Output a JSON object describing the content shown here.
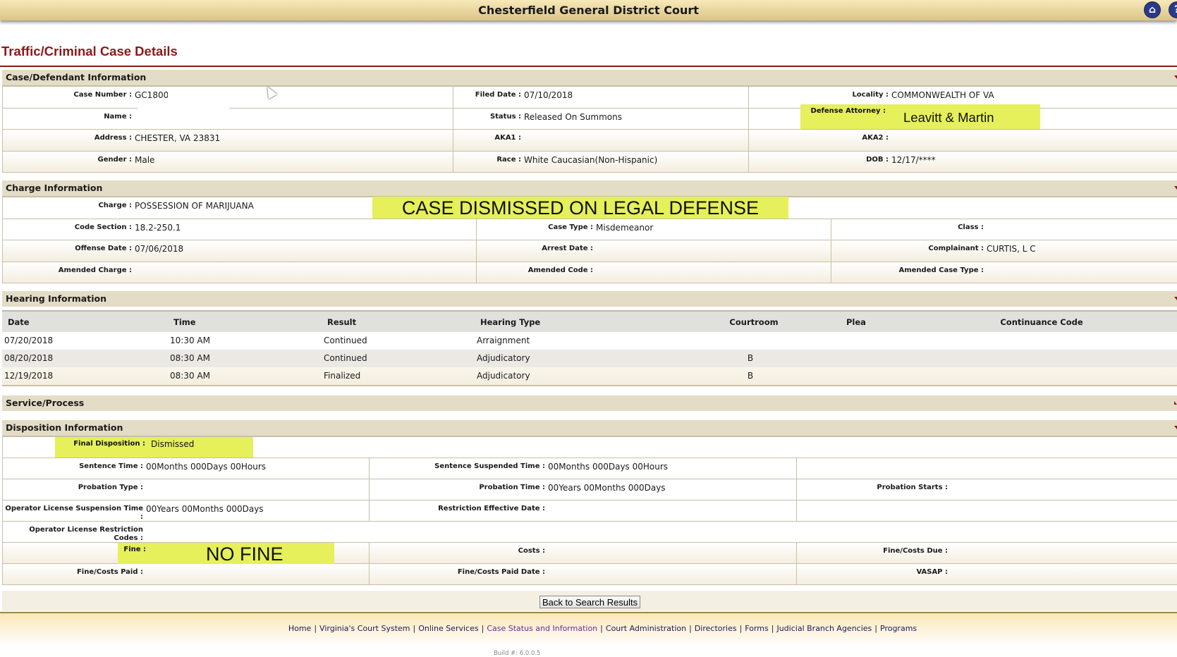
{
  "header": {
    "title": "Chesterfield General District Court",
    "home_icon": "home-icon",
    "help_icon": "help-icon",
    "help_glyph": "?"
  },
  "page_title": "Traffic/Criminal Case Details",
  "case_info": {
    "title": "Case/Defendant Information",
    "rows": [
      [
        {
          "label": "Case Number :",
          "value": "GC1800"
        },
        {
          "label": "Filed Date :",
          "value": "07/10/2018"
        },
        {
          "label": "Locality :",
          "value": "COMMONWEALTH OF VA"
        }
      ],
      [
        {
          "label": "Name :",
          "value": ""
        },
        {
          "label": "Status :",
          "value": "Released On Summons"
        },
        {
          "label": "Defense Attorney :",
          "value": ""
        }
      ],
      [
        {
          "label": "Address :",
          "value": "CHESTER, VA 23831"
        },
        {
          "label": "AKA1 :",
          "value": ""
        },
        {
          "label": "AKA2 :",
          "value": ""
        }
      ],
      [
        {
          "label": "Gender :",
          "value": "Male"
        },
        {
          "label": "Race :",
          "value": "White Caucasian(Non-Hispanic)"
        },
        {
          "label": "DOB :",
          "value": "12/17/****"
        }
      ]
    ]
  },
  "charge_info": {
    "title": "Charge Information",
    "rows": [
      [
        {
          "label": "Charge :",
          "value": "POSSESSION OF MARIJUANA"
        }
      ],
      [
        {
          "label": "Code Section :",
          "value": "18.2-250.1"
        },
        {
          "label": "Case Type :",
          "value": "Misdemeanor"
        },
        {
          "label": "Class :",
          "value": ""
        }
      ],
      [
        {
          "label": "Offense Date :",
          "value": "07/06/2018"
        },
        {
          "label": "Arrest Date :",
          "value": ""
        },
        {
          "label": "Complainant :",
          "value": "CURTIS, L C"
        }
      ],
      [
        {
          "label": "Amended Charge :",
          "value": ""
        },
        {
          "label": "Amended Code :",
          "value": ""
        },
        {
          "label": "Amended Case Type :",
          "value": ""
        }
      ]
    ]
  },
  "hearing_info": {
    "title": "Hearing Information",
    "columns": [
      "Date",
      "Time",
      "Result",
      "Hearing Type",
      "Courtroom",
      "Plea",
      "Continuance Code"
    ],
    "rows": [
      [
        "07/20/2018",
        "10:30 AM",
        "Continued",
        "Arraignment",
        "",
        "",
        ""
      ],
      [
        "08/20/2018",
        "08:30 AM",
        "Continued",
        "Adjudicatory",
        "B",
        "",
        ""
      ],
      [
        "12/19/2018",
        "08:30 AM",
        "Finalized",
        "Adjudicatory",
        "B",
        "",
        ""
      ]
    ]
  },
  "service_process": {
    "title": "Service/Process"
  },
  "disposition_info": {
    "title": "Disposition Information",
    "rows": [
      [
        {
          "label": "Final Disposition :",
          "value": "Dismissed"
        }
      ],
      [
        {
          "label": "Sentence Time :",
          "value": "00Months 000Days 00Hours"
        },
        {
          "label": "Sentence Suspended Time :",
          "value": "00Months 000Days 00Hours"
        },
        {
          "label": "",
          "value": ""
        }
      ],
      [
        {
          "label": "Probation Type :",
          "value": ""
        },
        {
          "label": "Probation Time :",
          "value": "00Years 00Months 000Days"
        },
        {
          "label": "Probation Starts :",
          "value": ""
        }
      ],
      [
        {
          "label": "Operator License Suspension Time :",
          "value": "00Years 00Months 000Days"
        },
        {
          "label": "Restriction Effective Date :",
          "value": ""
        },
        {
          "label": "",
          "value": ""
        }
      ],
      [
        {
          "label": "Operator License Restriction Codes :",
          "value": ""
        }
      ],
      [
        {
          "label": "Fine :",
          "value": ""
        },
        {
          "label": "Costs :",
          "value": ""
        },
        {
          "label": "Fine/Costs Due :",
          "value": ""
        }
      ],
      [
        {
          "label": "Fine/Costs Paid :",
          "value": ""
        },
        {
          "label": "Fine/Costs Paid Date :",
          "value": ""
        },
        {
          "label": "VASAP :",
          "value": ""
        }
      ]
    ]
  },
  "annotations": {
    "defense_attorney": "Leavitt & Martin",
    "charge_note": "CASE DISMISSED ON LEGAL DEFENSE",
    "fine_note": "NO FINE",
    "highlight_color": "#e5f05a"
  },
  "back_button": "Back to Search Results",
  "footer": {
    "links": [
      "Home",
      "Virginia's Court System",
      "Online Services",
      "Case Status and Information",
      "Court Administration",
      "Directories",
      "Forms",
      "Judicial Branch Agencies",
      "Programs"
    ],
    "build": "Build #: 6.0.0.5"
  }
}
